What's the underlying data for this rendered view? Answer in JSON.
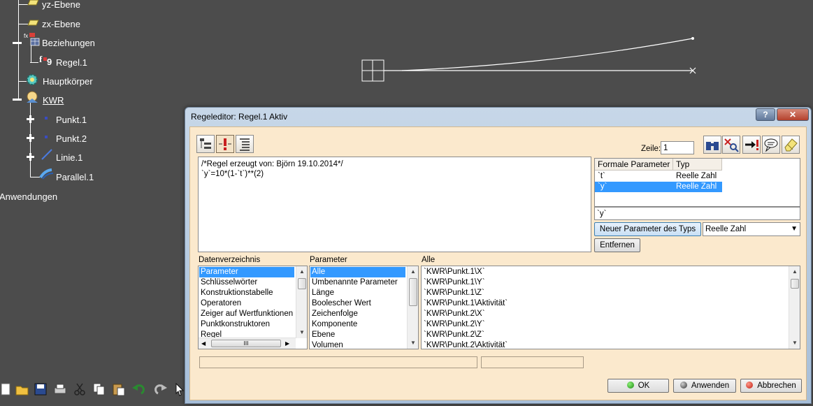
{
  "tree": {
    "items": [
      {
        "label": "yz-Ebene"
      },
      {
        "label": "zx-Ebene"
      },
      {
        "label": "Beziehungen"
      },
      {
        "label": "Regel.1"
      },
      {
        "label": "Hauptkörper"
      },
      {
        "label": "KWR"
      },
      {
        "label": "Punkt.1"
      },
      {
        "label": "Punkt.2"
      },
      {
        "label": "Linie.1"
      },
      {
        "label": "Parallel.1"
      },
      {
        "label": "Anwendungen"
      }
    ]
  },
  "dialog": {
    "title": "Regeleditor: Regel.1 Aktiv",
    "help_label": "?",
    "close_label": "✕",
    "line_label": "Zeile:",
    "line_value": "1",
    "editor_lines": [
      "/*Regel erzeugt von: Björn 19.10.2014*/",
      "`y`=10*(1-`t`)**(2)"
    ],
    "formal_params": {
      "headers": [
        "Formale Parameter",
        "Typ"
      ],
      "rows": [
        {
          "name": "`t`",
          "type": "Reelle Zahl"
        },
        {
          "name": "`y`",
          "type": "Reelle Zahl"
        }
      ],
      "selected_name": "`y`"
    },
    "new_param_label": "Neuer Parameter des Typs",
    "new_param_type": "Reelle Zahl",
    "remove_label": "Entfernen",
    "directory": {
      "header": "Datenverzeichnis",
      "items": [
        "Parameter",
        "Schlüsselwörter",
        "Konstruktionstabelle",
        "Operatoren",
        "Zeiger auf Wertfunktionen",
        "Punktkonstruktoren",
        "Regel"
      ],
      "hscroll_grip": "III"
    },
    "parameter": {
      "header": "Parameter",
      "items": [
        "Alle",
        "Umbenannte Parameter",
        "Länge",
        "Boolescher Wert",
        "Zeichenfolge",
        "Komponente",
        "Ebene",
        "Volumen"
      ]
    },
    "all": {
      "header": "Alle",
      "items": [
        "`KWR\\Punkt.1\\X`",
        "`KWR\\Punkt.1\\Y`",
        "`KWR\\Punkt.1\\Z`",
        "`KWR\\Punkt.1\\Aktivität`",
        "`KWR\\Punkt.2\\X`",
        "`KWR\\Punkt.2\\Y`",
        "`KWR\\Punkt.2\\Z`",
        "`KWR\\Punkt.2\\Aktivität`"
      ]
    },
    "ok_label": "OK",
    "apply_label": "Anwenden",
    "cancel_label": "Abbrechen"
  }
}
